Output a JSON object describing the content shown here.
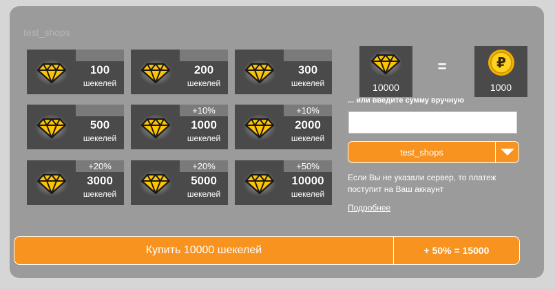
{
  "shop": {
    "title": "test_shops"
  },
  "packages": [
    {
      "amount": "100",
      "unit": "шекелей",
      "bonus": ""
    },
    {
      "amount": "200",
      "unit": "шекелей",
      "bonus": ""
    },
    {
      "amount": "300",
      "unit": "шекелей",
      "bonus": ""
    },
    {
      "amount": "500",
      "unit": "шекелей",
      "bonus": ""
    },
    {
      "amount": "1000",
      "unit": "шекелей",
      "bonus": "+10%"
    },
    {
      "amount": "2000",
      "unit": "шекелей",
      "bonus": "+10%"
    },
    {
      "amount": "3000",
      "unit": "шекелей",
      "bonus": "+20%"
    },
    {
      "amount": "5000",
      "unit": "шекелей",
      "bonus": "+20%"
    },
    {
      "amount": "10000",
      "unit": "шекелей",
      "bonus": "+50%"
    }
  ],
  "converter": {
    "gems_value": "10000",
    "equals": "=",
    "coins_value": "1000",
    "coin_symbol": "₽",
    "manual_label": "... или введите сумму вручную",
    "input_value": "",
    "input_placeholder": ""
  },
  "server": {
    "selected": "test_shops"
  },
  "notice": {
    "text": "Если Вы не указали сервер, то платеж поступит на Ваш аккаунт",
    "link": "Подробнее"
  },
  "purchase": {
    "label": "Купить 10000 шекелей",
    "bonus": "+ 50% = 15000"
  },
  "colors": {
    "accent": "#f7931e",
    "panel": "#9b9b9b",
    "tile": "#4a4a4a",
    "gem": "#ffc400"
  },
  "icons": {
    "gem": "diamond-icon",
    "coin": "ruble-coin-icon",
    "dropdown": "chevron-down-icon"
  }
}
